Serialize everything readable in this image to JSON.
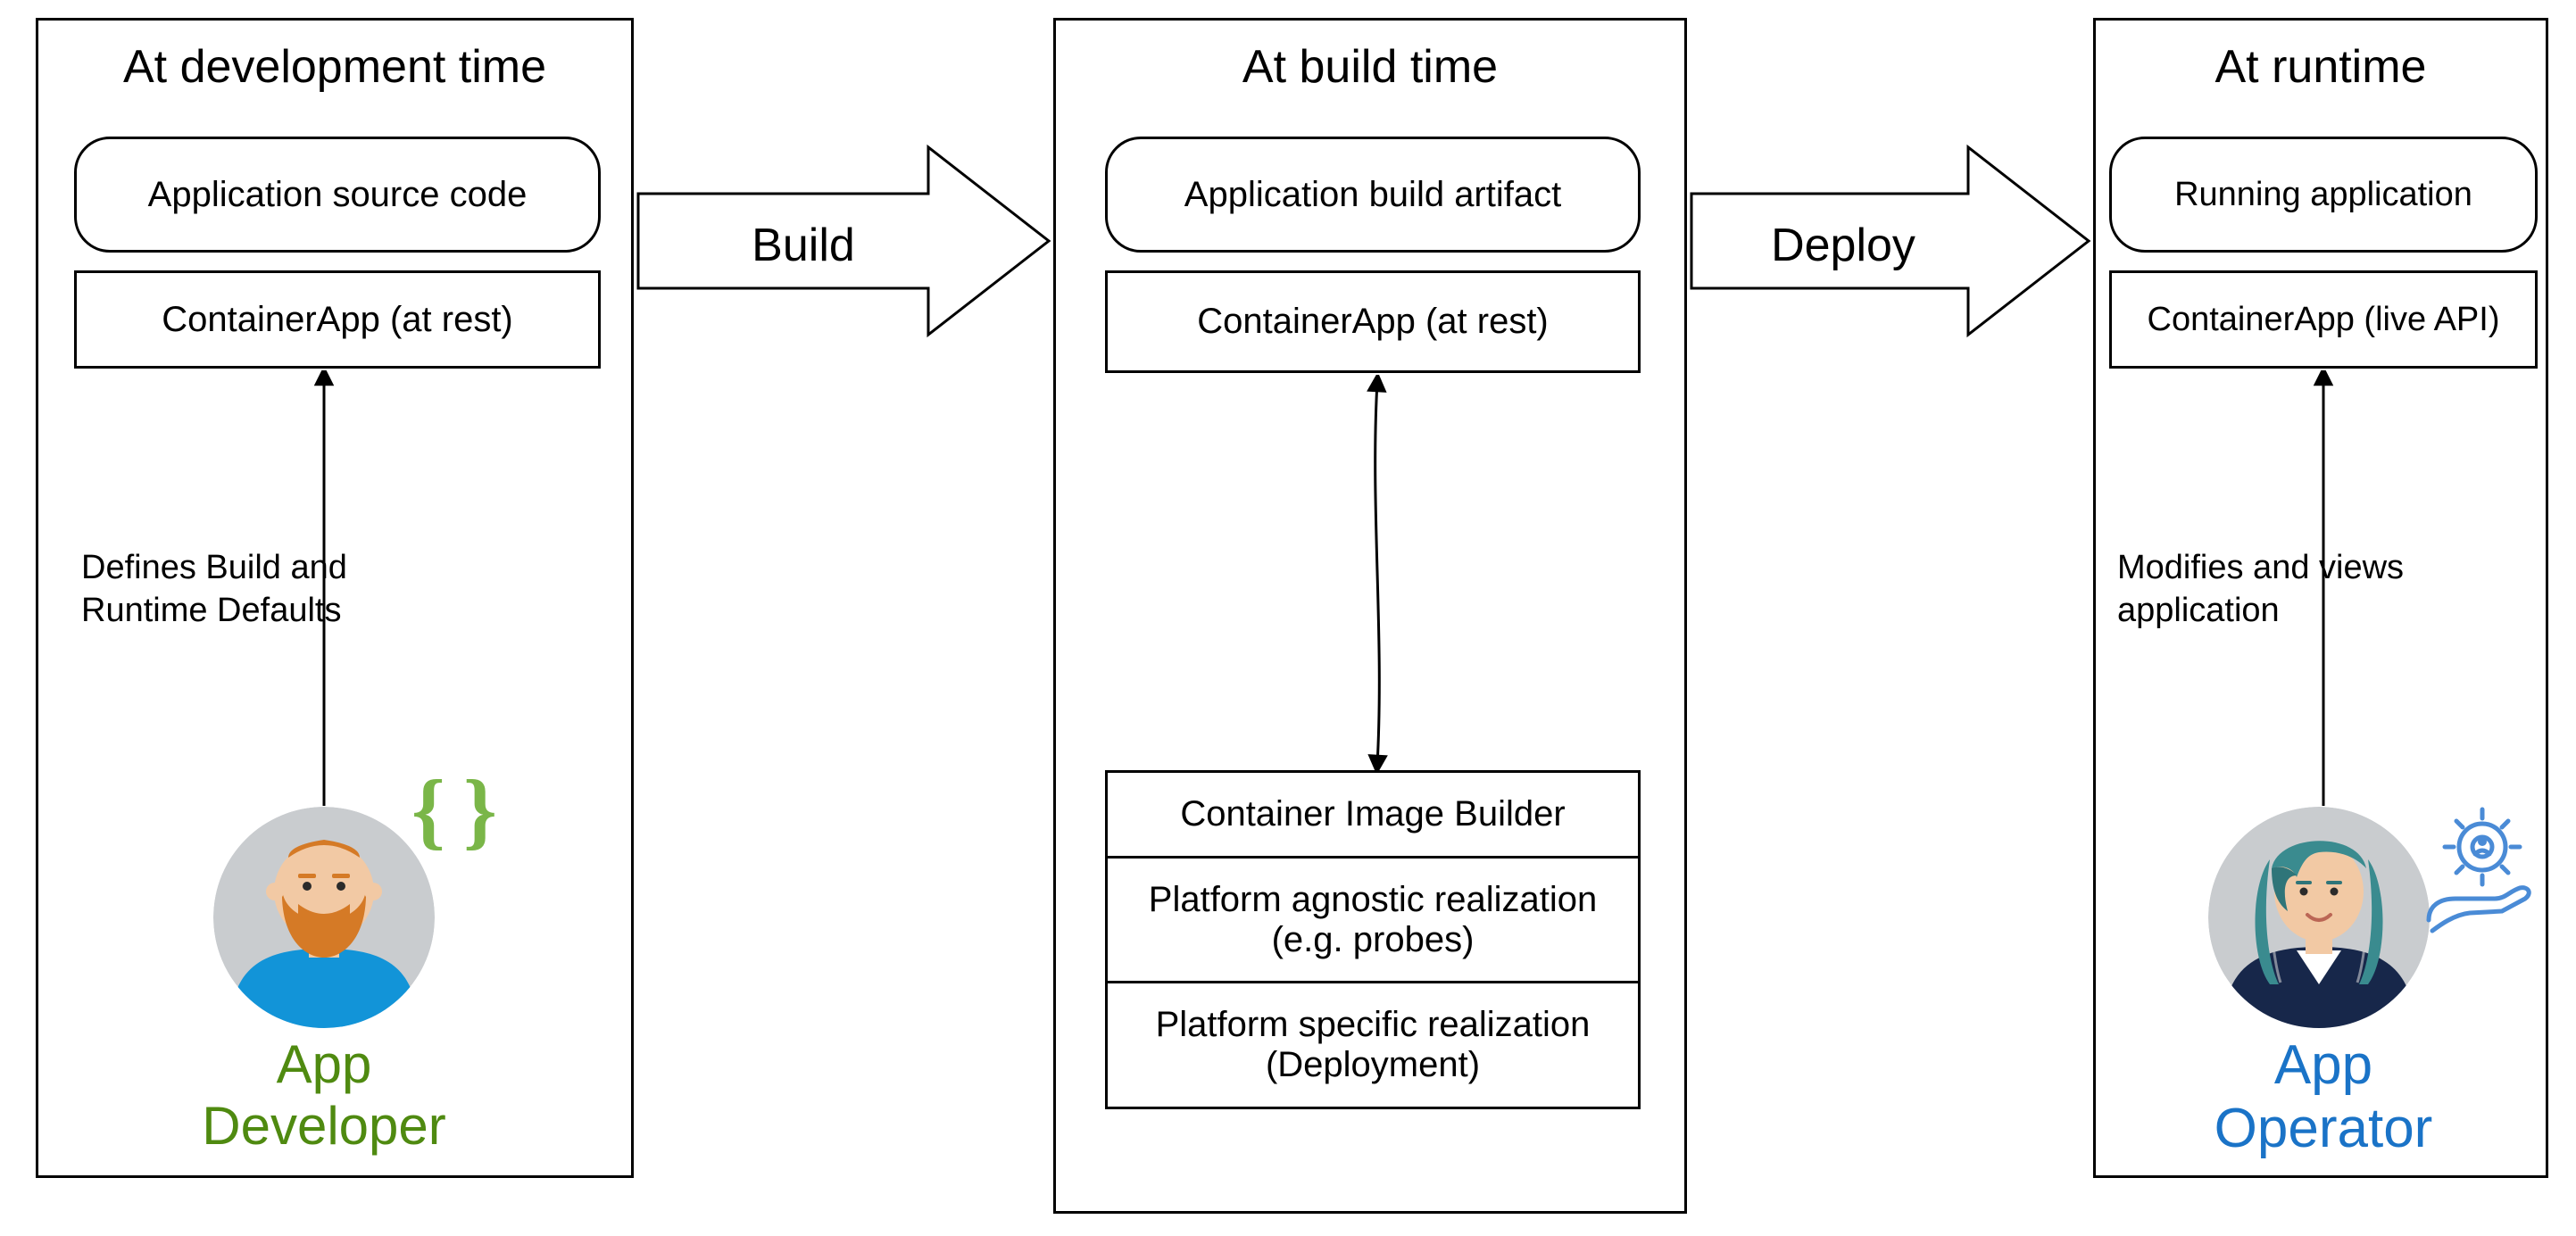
{
  "panels": {
    "development": {
      "title": "At development time",
      "source_box": "Application source code",
      "containerapp_box": "ContainerApp (at rest)",
      "arrow_annotation": "Defines Build and\nRuntime Defaults",
      "persona": "App\nDeveloper"
    },
    "build": {
      "title": "At build time",
      "artifact_box": "Application build artifact",
      "containerapp_box": "ContainerApp (at rest)",
      "stack": {
        "row1": "Container Image Builder",
        "row2": "Platform agnostic realization (e.g. probes)",
        "row3": "Platform specific realization (Deployment)"
      }
    },
    "runtime": {
      "title": "At runtime",
      "running_box": "Running application",
      "containerapp_box": "ContainerApp (live API)",
      "arrow_annotation": "Modifies and views\napplication",
      "persona": "App\nOperator"
    }
  },
  "arrows": {
    "build": "Build",
    "deploy": "Deploy"
  },
  "colors": {
    "developer_green": "#4f8a10",
    "operator_blue": "#1a73c7",
    "braces_green": "#7ab648",
    "avatar_bg": "#c9cccf",
    "dev_shirt": "#1294d8",
    "dev_beard": "#d57a26",
    "op_jacket": "#17274a",
    "op_hair": "#3a8b8f",
    "op_icon": "#4a8bd6"
  }
}
